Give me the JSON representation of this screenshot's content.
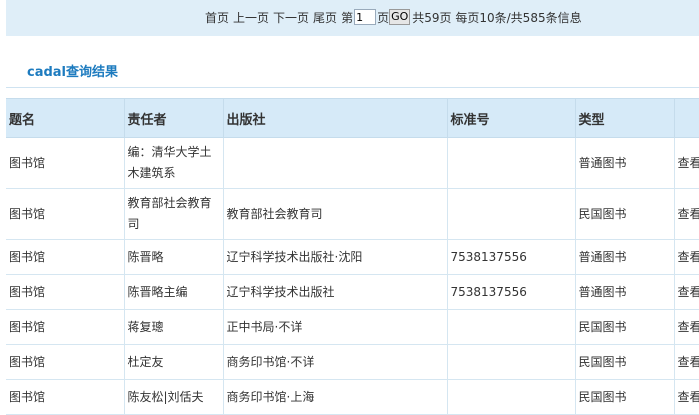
{
  "pager": {
    "first": "首页",
    "prev": "上一页",
    "next": "下一页",
    "last": "尾页",
    "page_prefix": "第",
    "page_value": "1",
    "page_suffix": "页",
    "go": "GO",
    "summary": "共59页 每页10条/共585条信息"
  },
  "section_title": "cadal查询结果",
  "table": {
    "headers": [
      "题名",
      "责任者",
      "出版社",
      "标准号",
      "类型",
      ""
    ],
    "rows": [
      {
        "title": "图书馆",
        "author": "编：清华大学土木建筑系",
        "publisher": "",
        "isbn": "",
        "type": "普通图书",
        "action": "查看"
      },
      {
        "title": "图书馆",
        "author": "教育部社会教育司",
        "publisher": "教育部社会教育司",
        "isbn": "",
        "type": "民国图书",
        "action": "查看"
      },
      {
        "title": "图书馆",
        "author": "陈晋略",
        "publisher": "辽宁科学技术出版社·沈阳",
        "isbn": "7538137556",
        "type": "普通图书",
        "action": "查看"
      },
      {
        "title": "图书馆",
        "author": "陈晋略主编",
        "publisher": "辽宁科学技术出版社",
        "isbn": "7538137556",
        "type": "普通图书",
        "action": "查看"
      },
      {
        "title": "图书馆",
        "author": "蒋复璁",
        "publisher": "正中书局·不详",
        "isbn": "",
        "type": "民国图书",
        "action": "查看"
      },
      {
        "title": "图书馆",
        "author": "杜定友",
        "publisher": "商务印书馆·不详",
        "isbn": "",
        "type": "民国图书",
        "action": "查看"
      },
      {
        "title": "图书馆",
        "author": "陈友松|刘佸夫",
        "publisher": "商务印书馆·上海",
        "isbn": "",
        "type": "民国图书",
        "action": "查看"
      }
    ]
  }
}
